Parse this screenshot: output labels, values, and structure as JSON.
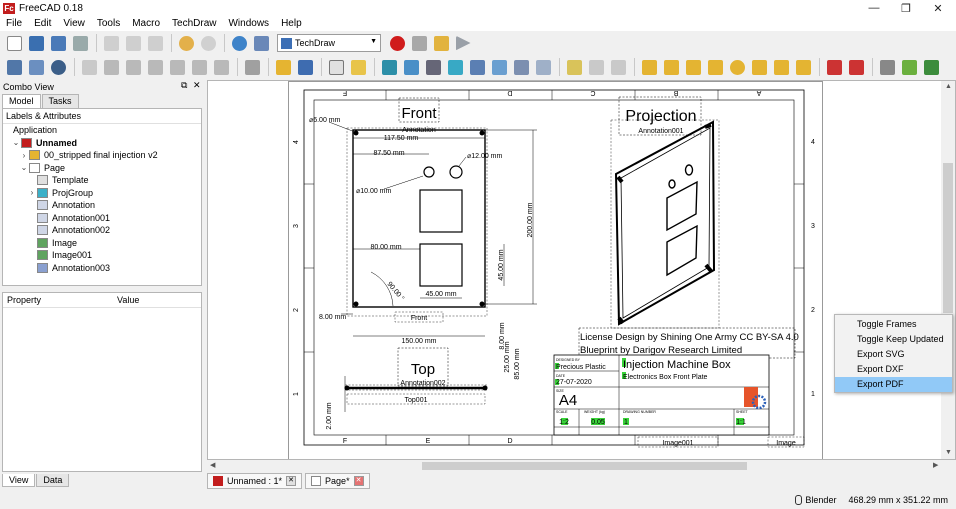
{
  "window": {
    "title": "FreeCAD 0.18",
    "logo": "Fc",
    "controls": [
      "—",
      "❐",
      "✕"
    ]
  },
  "menu": [
    "File",
    "Edit",
    "View",
    "Tools",
    "Macro",
    "TechDraw",
    "Windows",
    "Help"
  ],
  "toolbar": {
    "workbench": "TechDraw"
  },
  "combo": {
    "title": "Combo View",
    "tabs": [
      "Model",
      "Tasks"
    ],
    "tree_header": "Labels & Attributes",
    "tree": [
      {
        "label": "Application",
        "indent": 0,
        "arrow": "",
        "icon": ""
      },
      {
        "label": "Unnamed",
        "indent": 1,
        "arrow": "⌄",
        "icon": "document-icon"
      },
      {
        "label": "00_stripped final injection v2",
        "indent": 2,
        "arrow": "›",
        "icon": "part-icon"
      },
      {
        "label": "Page",
        "indent": 2,
        "arrow": "⌄",
        "icon": "page-icon"
      },
      {
        "label": "Template",
        "indent": 3,
        "arrow": "",
        "icon": "template-icon"
      },
      {
        "label": "ProjGroup",
        "indent": 3,
        "arrow": "›",
        "icon": "projgroup-icon"
      },
      {
        "label": "Annotation",
        "indent": 3,
        "arrow": "",
        "icon": "annotation-icon"
      },
      {
        "label": "Annotation001",
        "indent": 3,
        "arrow": "",
        "icon": "annotation-icon"
      },
      {
        "label": "Annotation002",
        "indent": 3,
        "arrow": "",
        "icon": "annotation-icon"
      },
      {
        "label": "Image",
        "indent": 3,
        "arrow": "",
        "icon": "image-icon"
      },
      {
        "label": "Image001",
        "indent": 3,
        "arrow": "",
        "icon": "image-icon"
      },
      {
        "label": "Annotation003",
        "indent": 3,
        "arrow": "",
        "icon": "annotation-edit-icon"
      }
    ],
    "prop_cols": [
      "Property",
      "Value"
    ],
    "bottom_tabs": [
      "View",
      "Data"
    ]
  },
  "drawing": {
    "col_labels": [
      "F",
      "E",
      "D",
      "C",
      "B",
      "A"
    ],
    "row_labels": [
      "4",
      "3",
      "2",
      "1"
    ],
    "views": {
      "front": "Front",
      "front_annot": "Annotation",
      "projection": "Projection",
      "projection_annot": "Annotation001",
      "top": "Top",
      "top_annot": "Annotation002",
      "front_label": "Front",
      "top_label": "Top001",
      "image_label": "Image001",
      "image2_label": "Image"
    },
    "dims": {
      "d_hole_small": "⌀6.00 mm",
      "w_117": "117.50 mm",
      "w_87": "87.50 mm",
      "d_hole_12": "⌀12.00 mm",
      "d_hole_10": "⌀10.00 mm",
      "h_200": "200.00 mm",
      "w_80": "80.00 mm",
      "h_45": "45.00 mm",
      "angle": "90.00 °",
      "w_45": "45.00 mm",
      "h_8": "8.00 mm",
      "w_150": "150.00 mm",
      "v_8": "8.00 mm",
      "v_25": "25.00 mm",
      "v_85": "85.00 mm",
      "top_2": "2.00 mm"
    },
    "license": {
      "line1": "License  Design by Shining One  Army CC BY-SA 4.0",
      "line2": "Blueprint by Darigov Research Limited"
    },
    "title_block": {
      "designed_by_label": "DESIGNED BY",
      "designed_by": "Precious Plastic",
      "date_label": "DATE",
      "date": "27-07-2020",
      "size_label": "SIZE",
      "size": "A4",
      "title": "Injection Machine Box",
      "subtitle": "Electronics Box Front Plate",
      "scale_label": "SCALE",
      "scale": "1:2",
      "weight_label": "WEIGHT (kg)",
      "weight": "0.05",
      "drawing_no_label": "DRAWING NUMBER",
      "drawing_no": "1",
      "sheet_label": "SHEET",
      "sheet": "1:1"
    }
  },
  "context_menu": [
    {
      "label": "Toggle Frames",
      "selected": false
    },
    {
      "label": "Toggle Keep Updated",
      "selected": false
    },
    {
      "label": "Export SVG",
      "selected": false
    },
    {
      "label": "Export DXF",
      "selected": false
    },
    {
      "label": "Export PDF",
      "selected": true
    }
  ],
  "mdi_tabs": [
    {
      "label": "Unnamed : 1*"
    },
    {
      "label": "Page*"
    }
  ],
  "status": {
    "nav_style": "Blender",
    "dimensions": "468.29 mm x 351.22 mm"
  },
  "colors": {
    "accent": "#3c6fb5",
    "selection": "#91c9f7",
    "logo_red": "#c21d1d",
    "title_green": "#39d339"
  }
}
